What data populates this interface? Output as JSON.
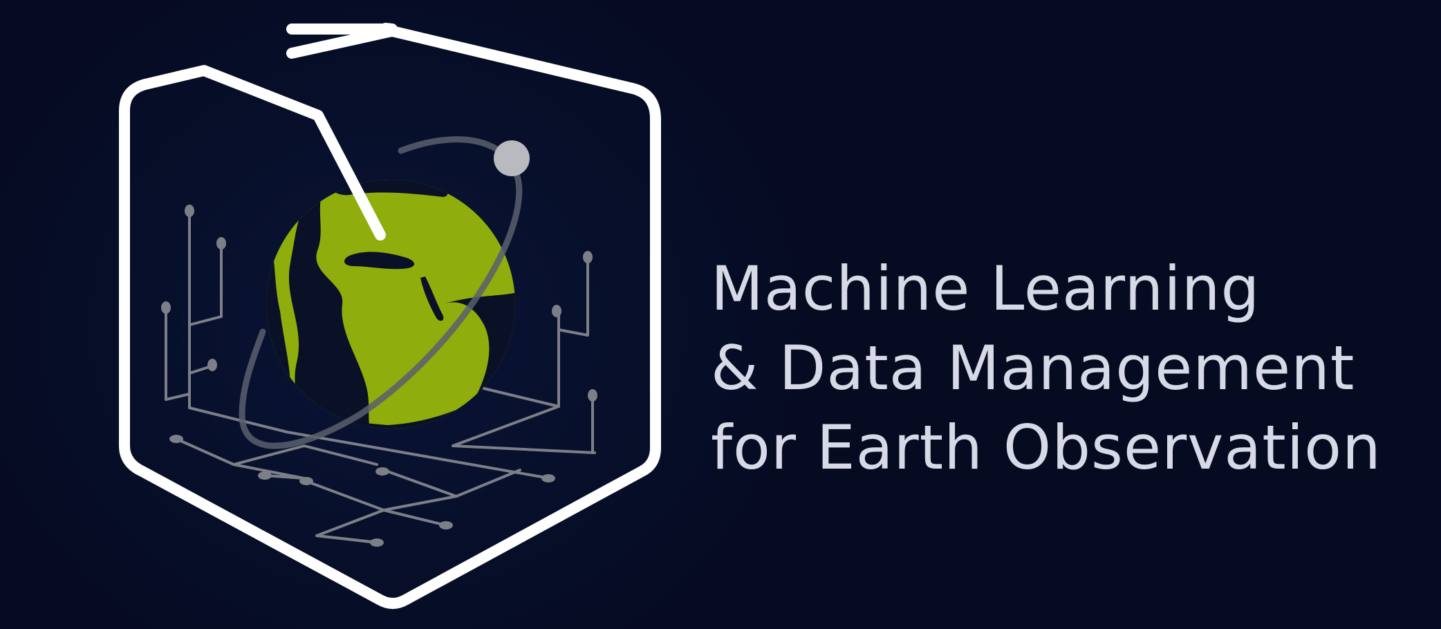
{
  "title_lines": [
    "Machine Learning",
    "& Data Management",
    "for Earth Observation"
  ],
  "colors": {
    "background": "#060b22",
    "frame": "#ffffff",
    "globe_land": "#8fad0c",
    "globe_ocean": "#0a1127",
    "circuit": "#7d7f88",
    "orbit": "#5b5f6e",
    "satellite": "#b8babf",
    "text": "#d7dae6"
  },
  "icons": [
    "hexagon-frame-icon",
    "globe-icon",
    "orbit-ring-icon",
    "satellite-icon",
    "circuit-traces-icon"
  ]
}
